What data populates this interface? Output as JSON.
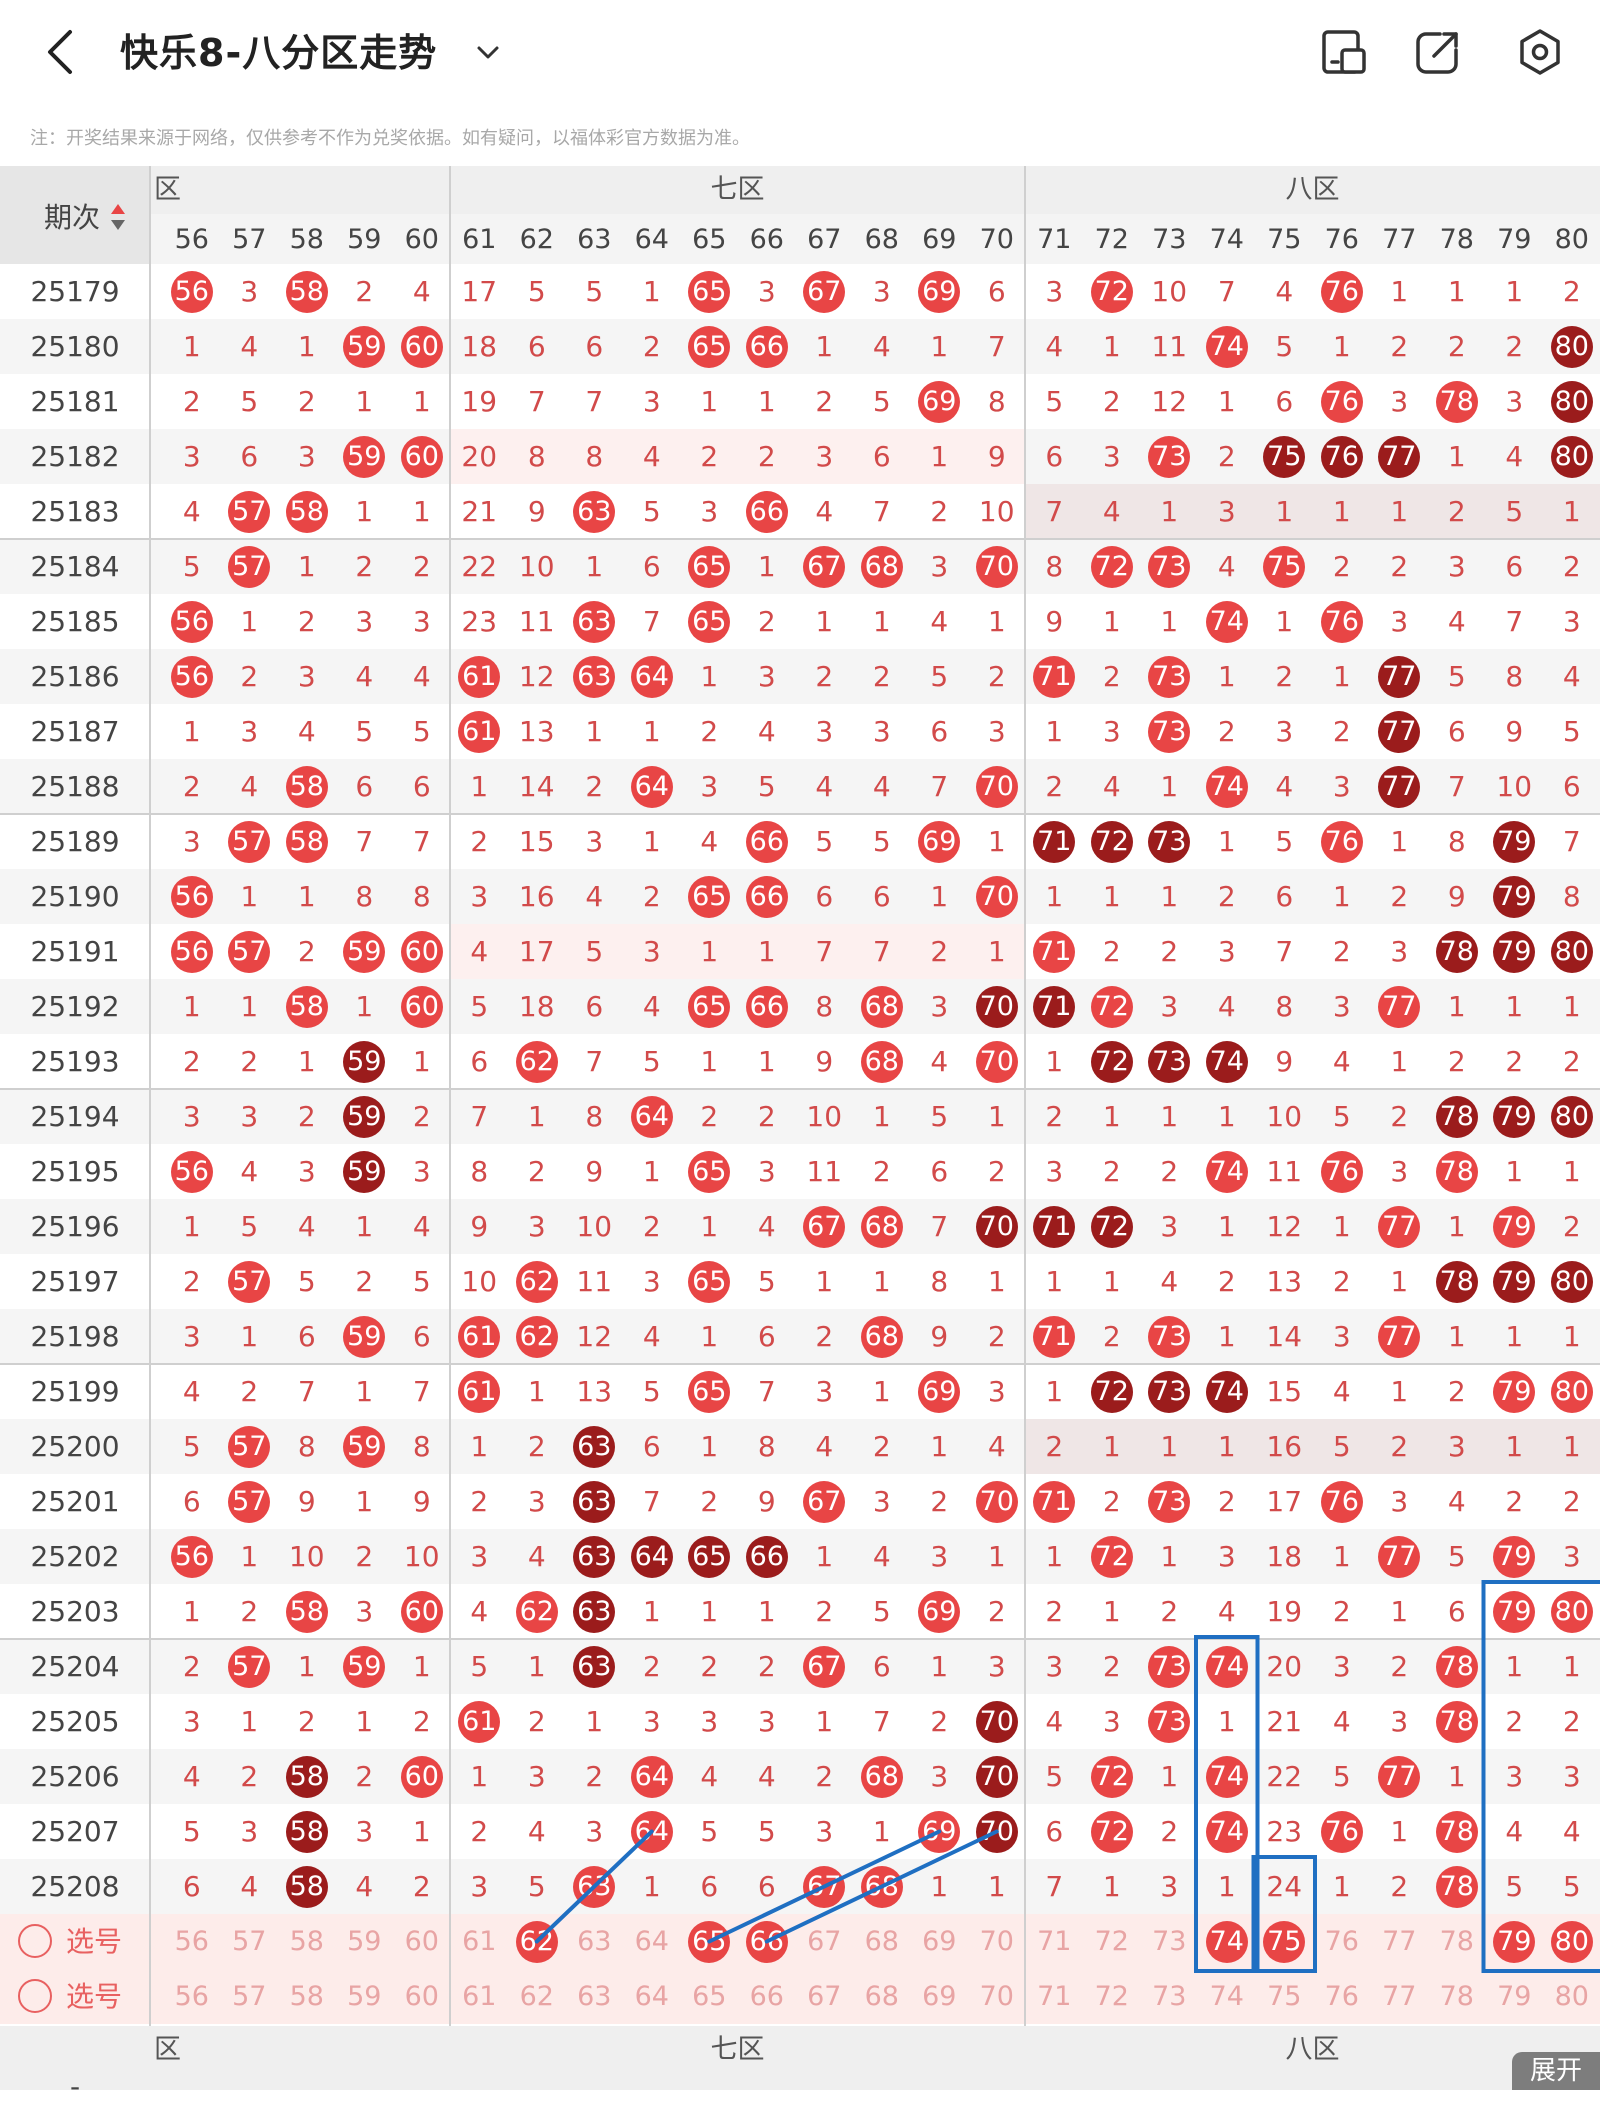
{
  "header": {
    "title": "快乐8-八分区走势",
    "note": "注：开奖结果来源于网络，仅供参考不作为兑奖依据。如有疑问，以福体彩官方数据为准。"
  },
  "table": {
    "period_label": "期次",
    "zone_labels": [
      "六区",
      "七区",
      "八区"
    ],
    "zone_labels_shown": [
      "区",
      "七区",
      "八区"
    ],
    "columns": [
      56,
      57,
      58,
      59,
      60,
      61,
      62,
      63,
      64,
      65,
      66,
      67,
      68,
      69,
      70,
      71,
      72,
      73,
      74,
      75,
      76,
      77,
      78,
      79,
      80
    ],
    "rows": [
      {
        "period": "25179",
        "cells": [
          "56",
          3,
          "58",
          2,
          4,
          17,
          5,
          5,
          1,
          "65",
          3,
          "67",
          3,
          "69",
          6,
          3,
          "72",
          10,
          7,
          4,
          "76",
          1,
          1,
          1,
          2
        ]
      },
      {
        "period": "25180",
        "cells": [
          1,
          4,
          1,
          "59",
          "60",
          18,
          6,
          6,
          2,
          "65",
          "66",
          1,
          4,
          1,
          7,
          4,
          1,
          11,
          "74",
          5,
          1,
          2,
          2,
          2,
          "D80"
        ]
      },
      {
        "period": "25181",
        "cells": [
          2,
          5,
          2,
          1,
          1,
          19,
          7,
          7,
          3,
          1,
          1,
          2,
          5,
          "69",
          8,
          5,
          2,
          12,
          1,
          6,
          "76",
          3,
          "78",
          3,
          "D80"
        ]
      },
      {
        "period": "25182",
        "cells": [
          3,
          6,
          3,
          "59",
          "60",
          20,
          8,
          8,
          4,
          2,
          2,
          3,
          6,
          1,
          9,
          6,
          3,
          "73",
          2,
          "D75",
          "D76",
          "D77",
          1,
          4,
          "D80"
        ]
      },
      {
        "period": "25183",
        "cells": [
          4,
          "57",
          "58",
          1,
          1,
          21,
          9,
          "63",
          5,
          3,
          "66",
          4,
          7,
          2,
          10,
          7,
          4,
          1,
          3,
          1,
          1,
          1,
          2,
          5,
          1
        ]
      },
      {
        "period": "25184",
        "cells": [
          5,
          "57",
          1,
          2,
          2,
          22,
          10,
          1,
          6,
          "65",
          1,
          "67",
          "68",
          3,
          "70",
          8,
          "72",
          "73",
          4,
          "75",
          2,
          2,
          3,
          6,
          2
        ]
      },
      {
        "period": "25185",
        "cells": [
          "56",
          1,
          2,
          3,
          3,
          23,
          11,
          "63",
          7,
          "65",
          2,
          1,
          1,
          4,
          1,
          9,
          1,
          1,
          "74",
          1,
          "76",
          3,
          4,
          7,
          3
        ]
      },
      {
        "period": "25186",
        "cells": [
          "56",
          2,
          3,
          4,
          4,
          "61",
          12,
          "63",
          "64",
          1,
          3,
          2,
          2,
          5,
          2,
          "71",
          2,
          "73",
          1,
          2,
          1,
          "D77",
          5,
          8,
          4
        ]
      },
      {
        "period": "25187",
        "cells": [
          1,
          3,
          4,
          5,
          5,
          "61",
          13,
          1,
          1,
          2,
          4,
          3,
          3,
          6,
          3,
          1,
          3,
          "73",
          2,
          3,
          2,
          "D77",
          6,
          9,
          5
        ]
      },
      {
        "period": "25188",
        "cells": [
          2,
          4,
          "58",
          6,
          6,
          1,
          14,
          2,
          "64",
          3,
          5,
          4,
          4,
          7,
          "70",
          2,
          4,
          1,
          "74",
          4,
          3,
          "D77",
          7,
          10,
          6
        ]
      },
      {
        "period": "25189",
        "cells": [
          3,
          "57",
          "58",
          7,
          7,
          2,
          15,
          3,
          1,
          4,
          "66",
          5,
          5,
          "69",
          1,
          "D71",
          "D72",
          "D73",
          1,
          5,
          "76",
          1,
          8,
          "D79",
          7
        ]
      },
      {
        "period": "25190",
        "cells": [
          "56",
          1,
          1,
          8,
          8,
          3,
          16,
          4,
          2,
          "65",
          "66",
          6,
          6,
          1,
          "70",
          1,
          1,
          1,
          2,
          6,
          1,
          2,
          9,
          "D79",
          8
        ]
      },
      {
        "period": "25191",
        "cells": [
          "56",
          "57",
          2,
          "59",
          "60",
          4,
          17,
          5,
          3,
          1,
          1,
          7,
          7,
          2,
          1,
          "71",
          2,
          2,
          3,
          7,
          2,
          3,
          "D78",
          "D79",
          "D80"
        ]
      },
      {
        "period": "25192",
        "cells": [
          1,
          1,
          "58",
          1,
          "60",
          5,
          18,
          6,
          4,
          "65",
          "66",
          8,
          "68",
          3,
          "D70",
          "D71",
          "72",
          3,
          4,
          8,
          3,
          "77",
          1,
          1,
          1
        ]
      },
      {
        "period": "25193",
        "cells": [
          2,
          2,
          1,
          "D59",
          1,
          6,
          "62",
          7,
          5,
          1,
          1,
          9,
          "68",
          4,
          "70",
          1,
          "D72",
          "D73",
          "D74",
          9,
          4,
          1,
          2,
          2,
          2
        ]
      },
      {
        "period": "25194",
        "cells": [
          3,
          3,
          2,
          "D59",
          2,
          7,
          1,
          8,
          "64",
          2,
          2,
          10,
          1,
          5,
          1,
          2,
          1,
          1,
          1,
          10,
          5,
          2,
          "D78",
          "D79",
          "D80"
        ]
      },
      {
        "period": "25195",
        "cells": [
          "56",
          4,
          3,
          "D59",
          3,
          8,
          2,
          9,
          1,
          "65",
          3,
          11,
          2,
          6,
          2,
          3,
          2,
          2,
          "74",
          11,
          "76",
          3,
          "78",
          1,
          1
        ]
      },
      {
        "period": "25196",
        "cells": [
          1,
          5,
          4,
          1,
          4,
          9,
          3,
          10,
          2,
          1,
          4,
          "67",
          "68",
          7,
          "D70",
          "D71",
          "D72",
          3,
          1,
          12,
          1,
          "77",
          1,
          "79",
          2
        ]
      },
      {
        "period": "25197",
        "cells": [
          2,
          "57",
          5,
          2,
          5,
          10,
          "62",
          11,
          3,
          "65",
          5,
          1,
          1,
          8,
          1,
          1,
          1,
          4,
          2,
          13,
          2,
          1,
          "D78",
          "D79",
          "D80"
        ]
      },
      {
        "period": "25198",
        "cells": [
          3,
          1,
          6,
          "59",
          6,
          "61",
          "62",
          12,
          4,
          1,
          6,
          2,
          "68",
          9,
          2,
          "71",
          2,
          "73",
          1,
          14,
          3,
          "77",
          1,
          1,
          1
        ]
      },
      {
        "period": "25199",
        "cells": [
          4,
          2,
          7,
          1,
          7,
          "61",
          1,
          13,
          5,
          "65",
          7,
          3,
          1,
          "69",
          3,
          1,
          "D72",
          "D73",
          "D74",
          15,
          4,
          1,
          2,
          "79",
          "80"
        ]
      },
      {
        "period": "25200",
        "cells": [
          5,
          "57",
          8,
          "59",
          8,
          1,
          2,
          "D63",
          6,
          1,
          8,
          4,
          2,
          1,
          4,
          2,
          1,
          1,
          1,
          16,
          5,
          2,
          3,
          1,
          1
        ]
      },
      {
        "period": "25201",
        "cells": [
          6,
          "57",
          9,
          1,
          9,
          2,
          3,
          "D63",
          7,
          2,
          9,
          "67",
          3,
          2,
          "70",
          "71",
          2,
          "73",
          2,
          17,
          "76",
          3,
          4,
          2,
          2
        ]
      },
      {
        "period": "25202",
        "cells": [
          "56",
          1,
          10,
          2,
          10,
          3,
          4,
          "D63",
          "D64",
          "D65",
          "D66",
          1,
          4,
          3,
          1,
          1,
          "72",
          1,
          3,
          18,
          1,
          "77",
          5,
          "79",
          3
        ]
      },
      {
        "period": "25203",
        "cells": [
          1,
          2,
          "58",
          3,
          "60",
          4,
          "62",
          "D63",
          1,
          1,
          1,
          2,
          5,
          "69",
          2,
          2,
          1,
          2,
          4,
          19,
          2,
          1,
          6,
          "79",
          "80"
        ]
      },
      {
        "period": "25204",
        "cells": [
          2,
          "57",
          1,
          "59",
          1,
          5,
          1,
          "D63",
          2,
          2,
          2,
          "67",
          6,
          1,
          3,
          3,
          2,
          "73",
          "74",
          20,
          3,
          2,
          "78",
          1,
          1
        ]
      },
      {
        "period": "25205",
        "cells": [
          3,
          1,
          2,
          1,
          2,
          "61",
          2,
          1,
          3,
          3,
          3,
          1,
          7,
          2,
          "D70",
          4,
          3,
          "73",
          1,
          21,
          4,
          3,
          "78",
          2,
          2
        ]
      },
      {
        "period": "25206",
        "cells": [
          4,
          2,
          "D58",
          2,
          "60",
          1,
          3,
          2,
          "64",
          4,
          4,
          2,
          "68",
          3,
          "D70",
          5,
          "72",
          1,
          "74",
          22,
          5,
          "77",
          1,
          3,
          3
        ]
      },
      {
        "period": "25207",
        "cells": [
          5,
          3,
          "D58",
          3,
          1,
          2,
          4,
          3,
          "64",
          5,
          5,
          3,
          1,
          "69",
          "D70",
          6,
          "72",
          2,
          "74",
          23,
          "76",
          1,
          "78",
          4,
          4
        ]
      },
      {
        "period": "25208",
        "cells": [
          6,
          4,
          "D58",
          4,
          2,
          3,
          5,
          "63",
          1,
          6,
          6,
          "67",
          "68",
          1,
          1,
          7,
          1,
          3,
          1,
          24,
          1,
          2,
          "78",
          5,
          5
        ]
      }
    ],
    "select_rows": [
      {
        "label": "选号",
        "selected": [
          62,
          65,
          66,
          74,
          75,
          79,
          80
        ]
      },
      {
        "label": "选号",
        "selected": []
      }
    ],
    "expand_label": "展开",
    "bottom_marker": "-"
  },
  "colors": {
    "ball_red": "#e84545",
    "ball_dark": "#9b1c1c",
    "miss_text": "#d24a4a",
    "select_bg": "#fdecea",
    "highlight_box": "#1f6fc2",
    "trend_line": "#1f6fc2"
  },
  "icons": [
    "back-arrow-icon",
    "chevron-down-icon",
    "phone-screen-icon",
    "share-icon",
    "settings-icon",
    "sort-icon",
    "radio-icon"
  ]
}
